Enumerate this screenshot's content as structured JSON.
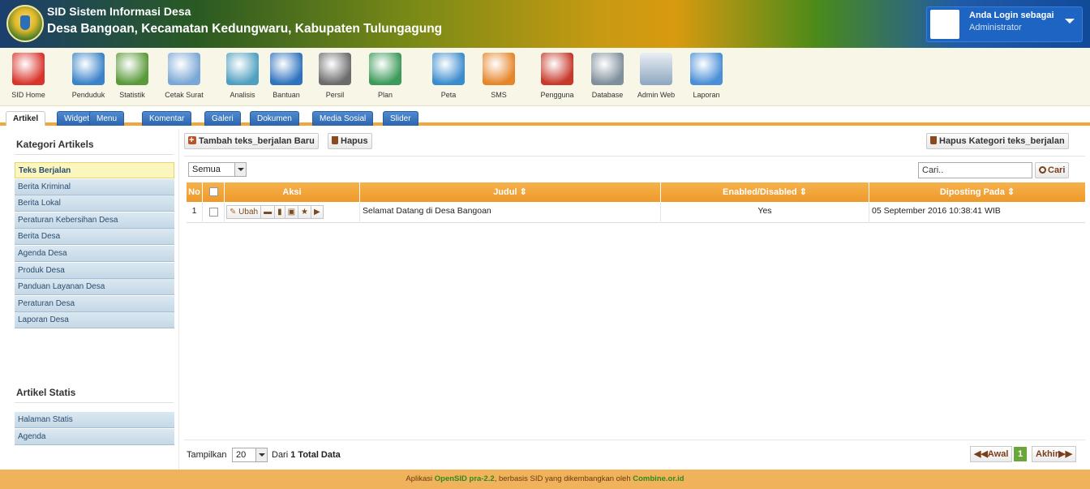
{
  "header": {
    "title_line1": "SID Sistem Informasi Desa",
    "title_line2": "Desa Bangoan, Kecamatan Kedungwaru, Kabupaten Tulungagung",
    "login_line1": "Anda Login sebagai",
    "login_line2": "Administrator"
  },
  "toolbar": [
    {
      "label": "SID Home",
      "icon": "home-icon",
      "color": "#d9342b"
    },
    {
      "label": "Penduduk",
      "icon": "people-icon",
      "color": "#3a83c9"
    },
    {
      "label": "Statistik",
      "icon": "chart-icon",
      "color": "#5a9a3a"
    },
    {
      "label": "Cetak Surat",
      "icon": "document-icon",
      "color": "#7aa7d6"
    },
    {
      "label": "Analisis",
      "icon": "binder-icon",
      "color": "#4fa0c0"
    },
    {
      "label": "Bantuan",
      "icon": "book-icon",
      "color": "#2f73c0"
    },
    {
      "label": "Persil",
      "icon": "map-fold-icon",
      "color": "#6c6c6c"
    },
    {
      "label": "Plan",
      "icon": "plan-icon",
      "color": "#3c9a5a"
    },
    {
      "label": "Peta",
      "icon": "globe-icon",
      "color": "#3b8ccf"
    },
    {
      "label": "SMS",
      "icon": "sms-icon",
      "color": "#e6862a"
    },
    {
      "label": "Pengguna",
      "icon": "users-icon",
      "color": "#c7392b"
    },
    {
      "label": "Database",
      "icon": "database-icon",
      "color": "#7f8f9c"
    },
    {
      "label": "Admin Web",
      "icon": "admin-web-icon",
      "color": "#8ca6bf"
    },
    {
      "label": "Laporan",
      "icon": "envelope-icon",
      "color": "#4a8fd8"
    }
  ],
  "tabs": [
    "Artikel",
    "Widget",
    "Menu",
    "Komentar",
    "Galeri",
    "Dokumen",
    "Media Sosial",
    "Slider"
  ],
  "sidebar": {
    "heading1": "Kategori Artikels",
    "categories": [
      "Teks Berjalan",
      "Berita Kriminal",
      "Berita Lokal",
      "Peraturan Kebersihan Desa",
      "Berita Desa",
      "Agenda Desa",
      "Produk Desa",
      "Panduan Layanan Desa",
      "Peraturan Desa",
      "Laporan Desa"
    ],
    "heading2": "Artikel Statis",
    "static_items": [
      "Halaman Statis",
      "Agenda"
    ]
  },
  "main": {
    "add_button": "Tambah teks_berjalan Baru",
    "delete_button": "Hapus",
    "delete_category_button": "Hapus Kategori teks_berjalan",
    "filter_value": "Semua",
    "search_placeholder": "Cari..",
    "search_button": "Cari",
    "columns": [
      "No",
      "Aksi",
      "Judul ⇕",
      "Enabled/Disabled ⇕",
      "Diposting Pada ⇕"
    ],
    "rows": [
      {
        "no": "1",
        "edit_label": "Ubah",
        "judul": "Selamat Datang di Desa Bangoan",
        "enabled": "Yes",
        "posted": "05 September 2016 10:38:41 WIB"
      }
    ],
    "show_label": "Tampilkan",
    "page_size": "20",
    "total_prefix": "Dari",
    "total_count": "1",
    "total_suffix": "Total Data",
    "pager_first": "Awal",
    "pager_current": "1",
    "pager_last": "Akhir"
  },
  "footer": {
    "prefix": "Aplikasi",
    "app_name": "OpenSID pra-2.2",
    "middle": ", berbasis SID yang dikembangkan oleh",
    "org": "Combine.or.id"
  }
}
